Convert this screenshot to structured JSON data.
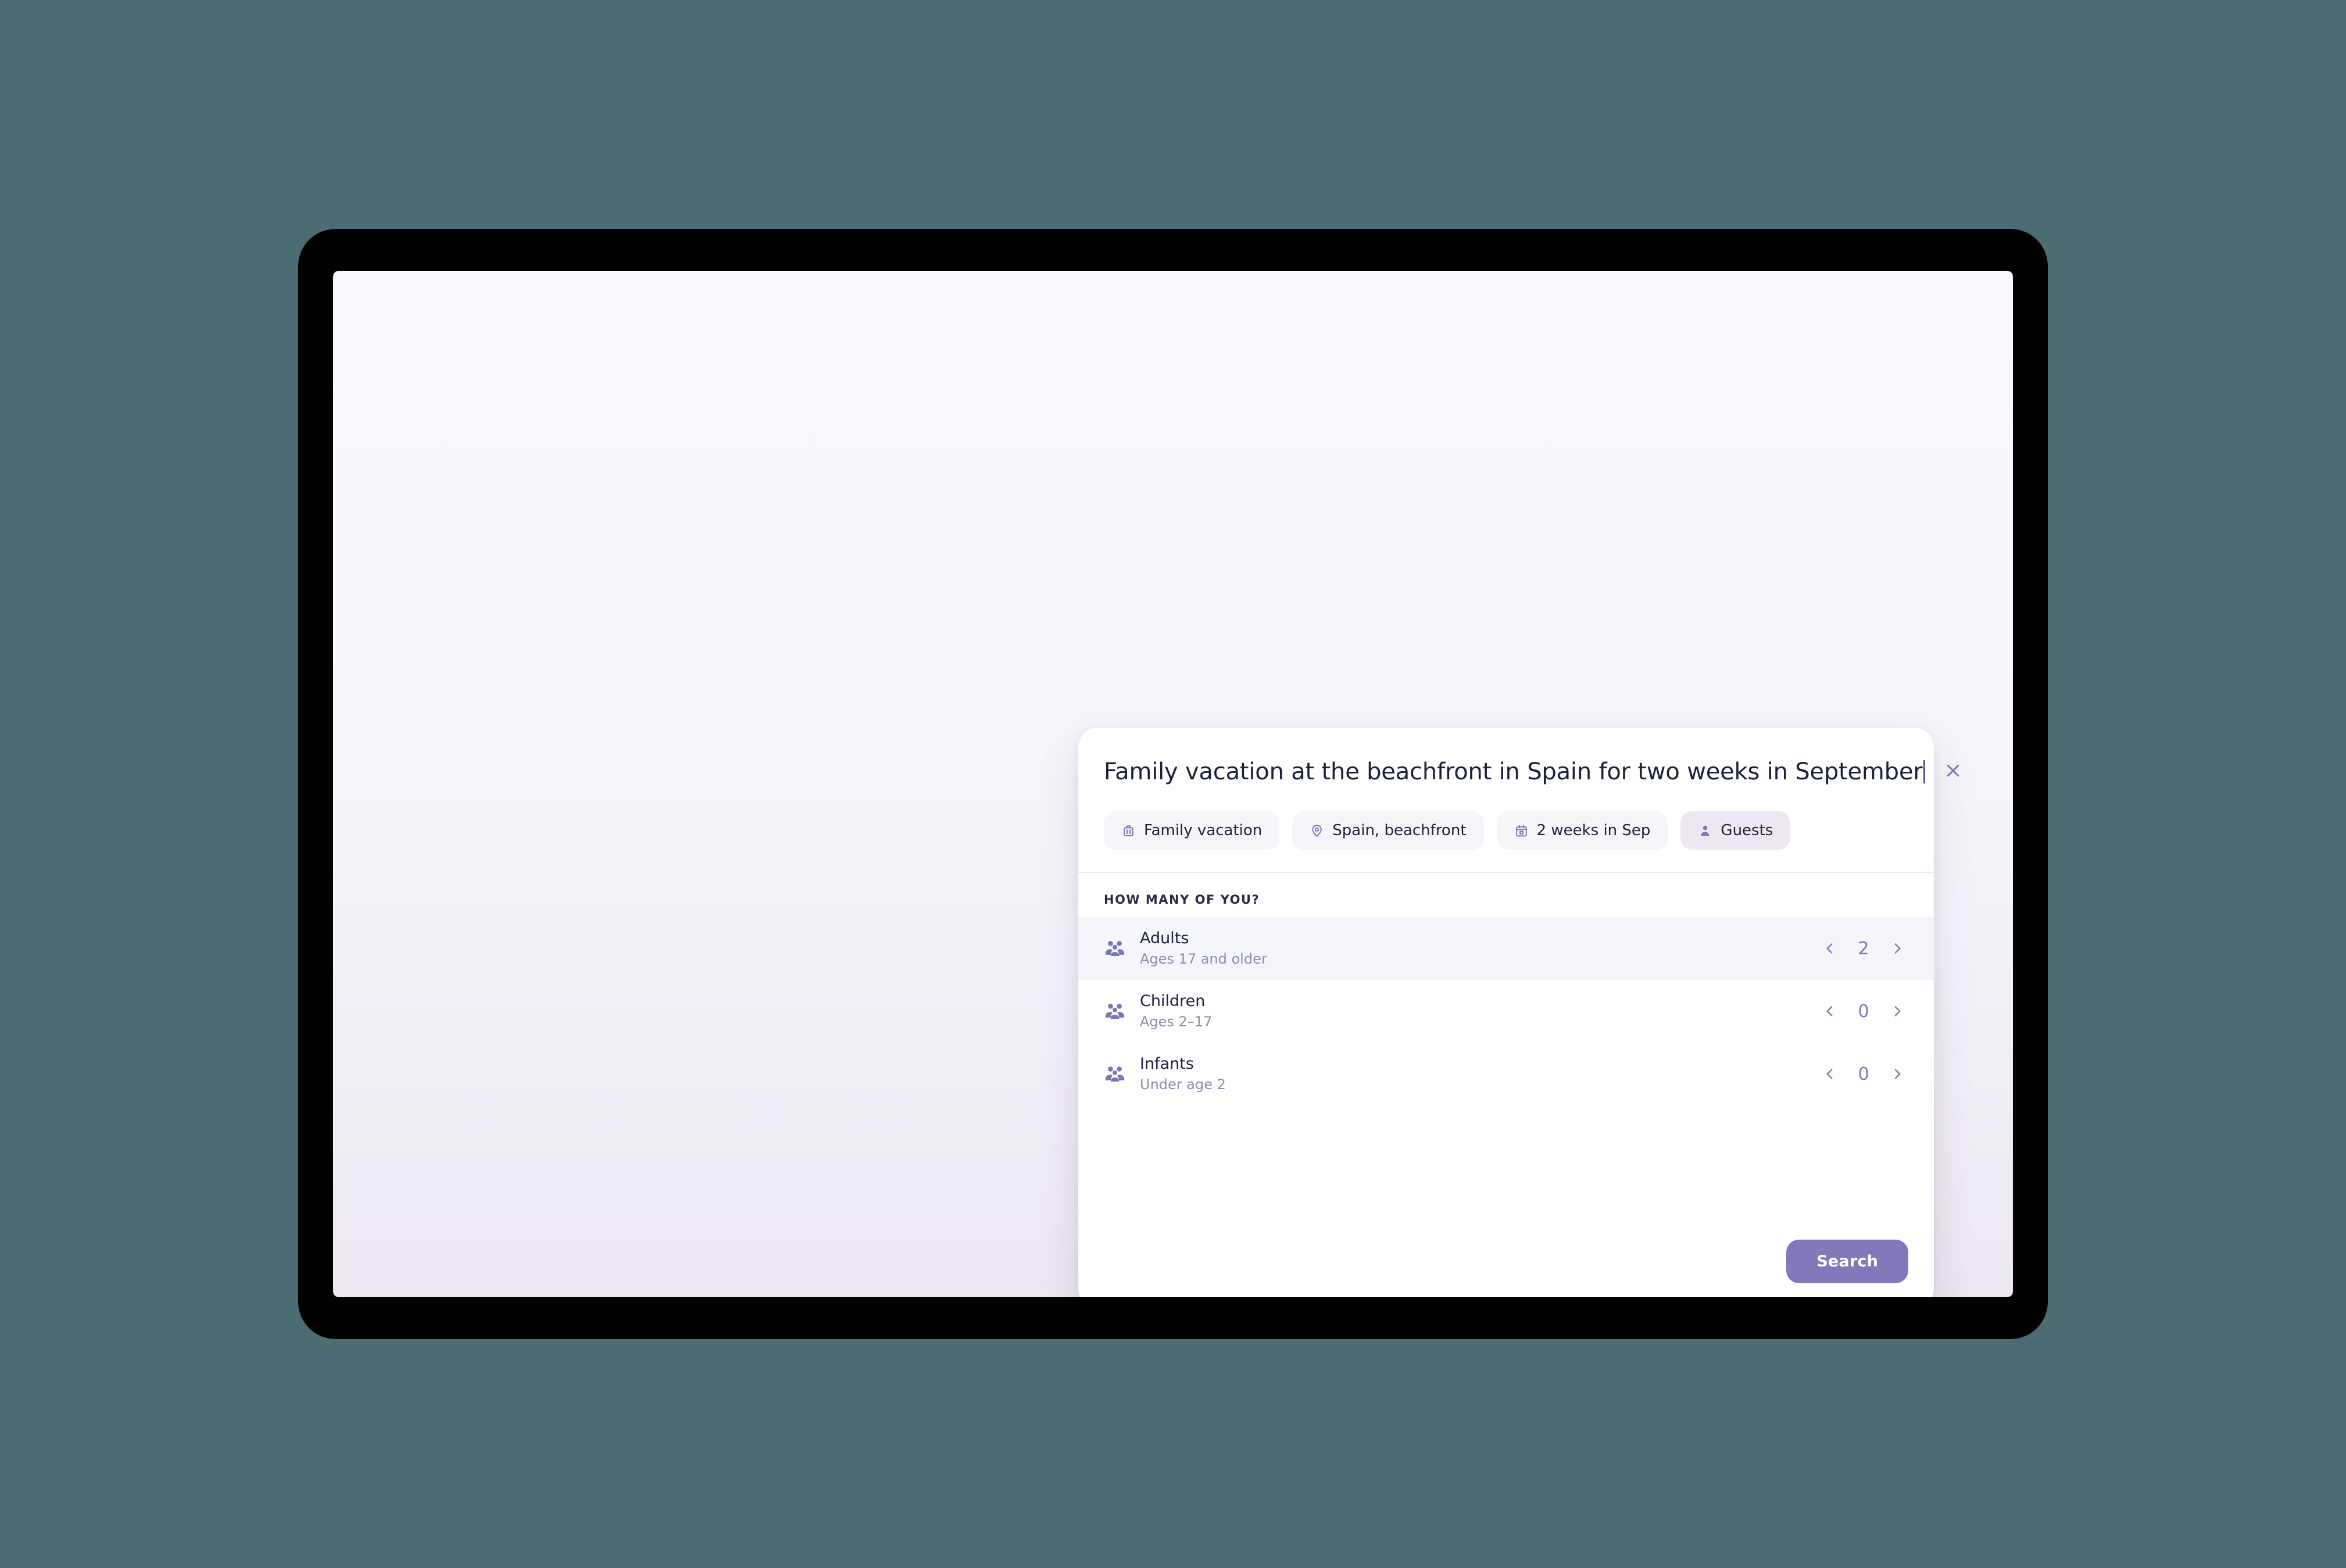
{
  "colors": {
    "page_background": "#4d6b73",
    "device_bezel": "#000000",
    "screen_top": "#f7f9fd",
    "screen_bottom": "#ece7f1",
    "card_background": "#ffffff",
    "accent_purple": "#8279ba",
    "icon_purple": "#7d76b4",
    "chip_background": "#f5f5fa",
    "chip_active_background": "#ece7f3",
    "row_highlight": "#f5f6fb",
    "text_primary": "#1d2138",
    "text_muted": "#8e8cb2",
    "divider": "#eceaf4"
  },
  "card": {
    "query": {
      "value": "Family vacation at the beachfront in Spain for two weeks in September",
      "placeholder": "Describe your trip",
      "caret_visible": true
    },
    "close": {
      "icon": "close-icon",
      "label": "Close"
    },
    "chips": [
      {
        "icon": "suitcase-icon",
        "label": "Family vacation",
        "active": false
      },
      {
        "icon": "map-pin-icon",
        "label": "Spain, beachfront",
        "active": false
      },
      {
        "icon": "calendar-icon",
        "label": "2 weeks in Sep",
        "active": false
      },
      {
        "icon": "person-icon",
        "label": "Guests",
        "active": true
      }
    ],
    "guests": {
      "section_label": "HOW MANY OF YOU?",
      "rows": [
        {
          "icon": "people-group-icon",
          "name": "Adults",
          "subtitle": "Ages 17 and older",
          "value": "2",
          "decrement_icon": "chevron-left-icon",
          "increment_icon": "chevron-right-icon",
          "highlighted": true
        },
        {
          "icon": "people-group-icon",
          "name": "Children",
          "subtitle": "Ages 2–17",
          "value": "0",
          "decrement_icon": "chevron-left-icon",
          "increment_icon": "chevron-right-icon",
          "highlighted": false
        },
        {
          "icon": "people-group-icon",
          "name": "Infants",
          "subtitle": "Under age 2",
          "value": "0",
          "decrement_icon": "chevron-left-icon",
          "increment_icon": "chevron-right-icon",
          "highlighted": false
        }
      ]
    },
    "footer": {
      "search_label": "Search"
    }
  }
}
